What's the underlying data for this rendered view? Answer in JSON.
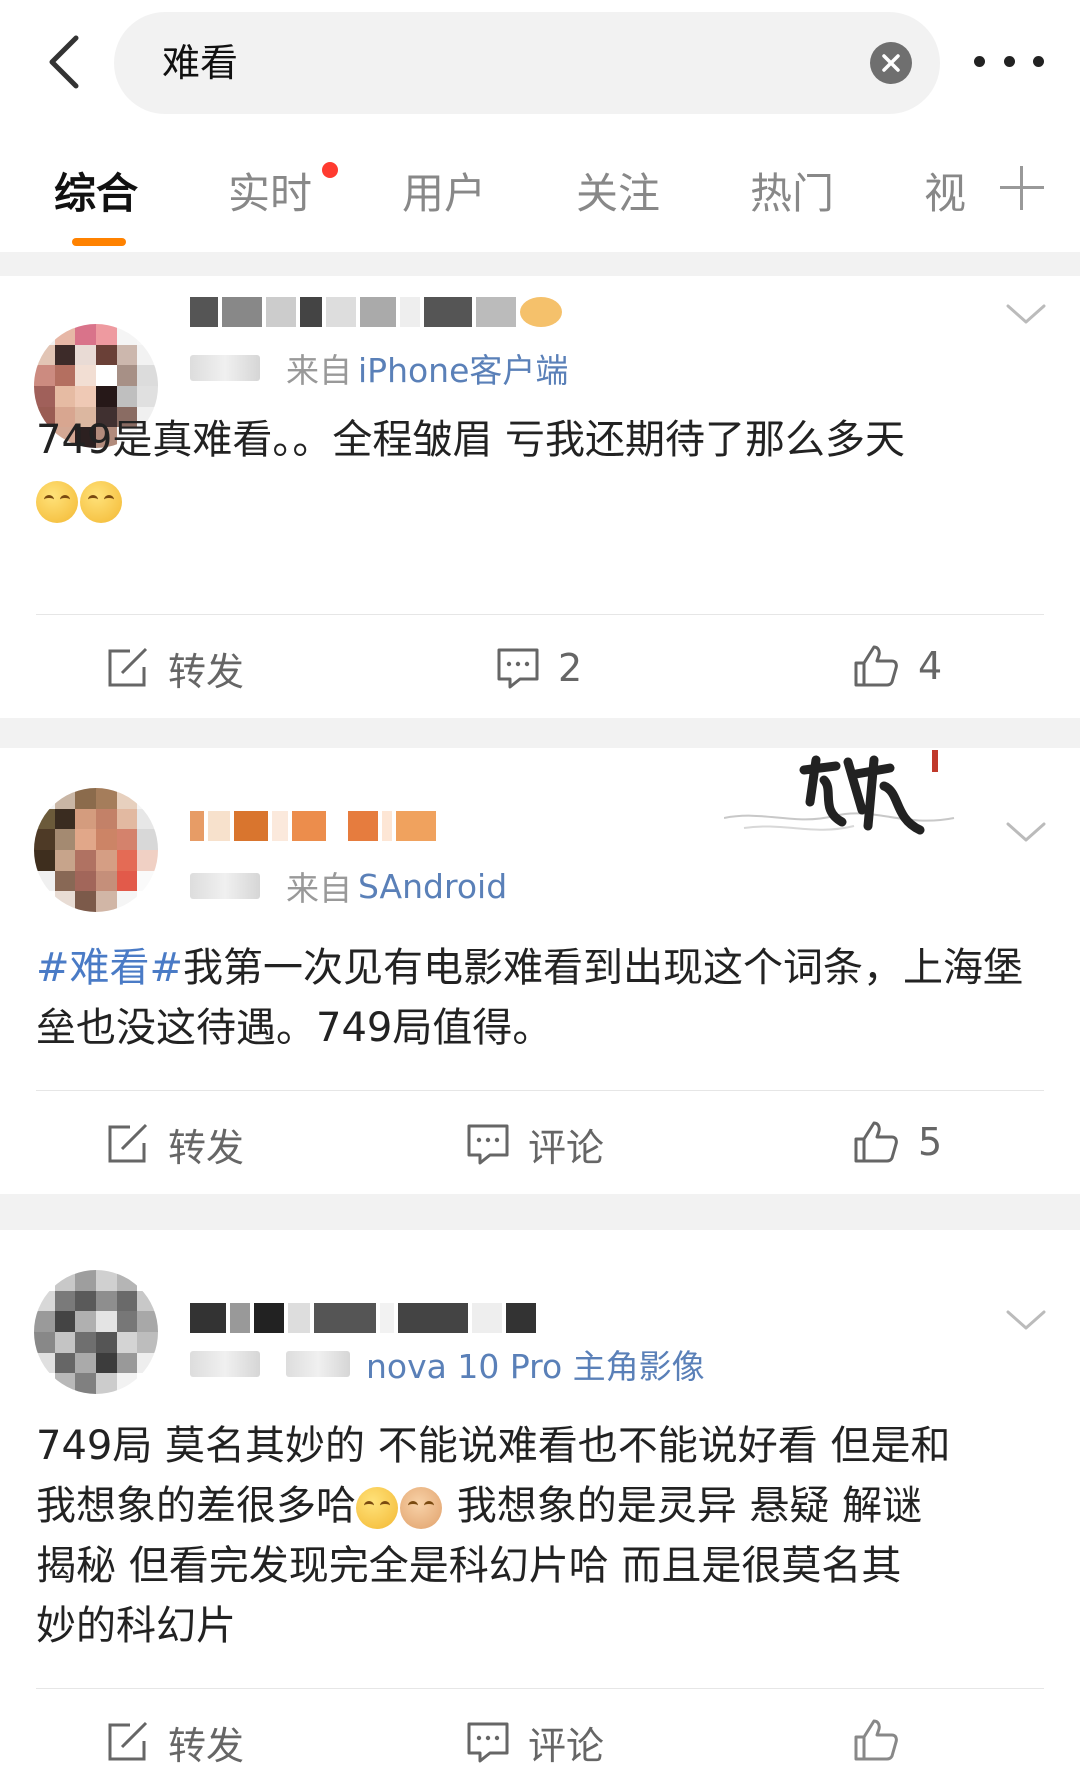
{
  "search": {
    "query": "难看"
  },
  "tabs": [
    {
      "label": "综合"
    },
    {
      "label": "实时"
    },
    {
      "label": "用户"
    },
    {
      "label": "关注"
    },
    {
      "label": "热门"
    },
    {
      "label": "视"
    }
  ],
  "posts": [
    {
      "source_prefix": "来自",
      "source": "iPhone客户端",
      "content": "749是真难看。。全程皱眉 亏我还期待了那么多天",
      "emoji_count_label": "",
      "repost_label": "转发",
      "comment_label": "2",
      "like_label": "4"
    },
    {
      "source_prefix": "来自",
      "source": "SAndroid",
      "topic": "#难看#",
      "content": "我第一次见有电影难看到出现这个词条，上海堡垒也没这待遇。749局值得。",
      "repost_label": "转发",
      "comment_label": "评论",
      "like_label": "5"
    },
    {
      "source": "nova 10 Pro 主角影像",
      "content_line1": "749局 莫名其妙的 不能说难看也不能说好看 但是和",
      "content_line2a": "我想象的差很多哈",
      "content_line2b": " 我想象的是灵异 悬疑 解谜",
      "content_line3": "揭秘 但看完发现完全是科幻片哈 而且是很莫名其",
      "content_line4": "妙的科幻片",
      "repost_label": "转发",
      "comment_label": "评论"
    }
  ],
  "colors": {
    "accent": "#ff8200",
    "link": "#4a7bc6",
    "source_link": "#5a80b8",
    "gap": "#f2f2f2"
  }
}
